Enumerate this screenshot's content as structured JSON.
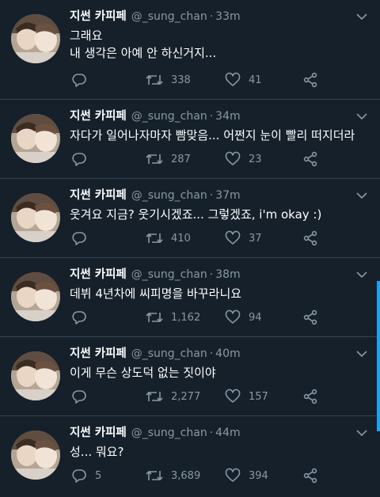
{
  "colors": {
    "background": "#15202b",
    "divider": "#38444d",
    "secondary_text": "#8899a6",
    "scroll_accent": "#1da1f2"
  },
  "tweets": [
    {
      "name": "지썬 카피페",
      "handle": "@_sung_chan",
      "sep": "·",
      "time": "33m",
      "lines": [
        "그래요",
        "내 생각은 아예 안 하신거지..."
      ],
      "replies": "",
      "retweets": "338",
      "likes": "41"
    },
    {
      "name": "지썬 카피페",
      "handle": "@_sung_chan",
      "sep": "·",
      "time": "34m",
      "lines": [
        "자다가 일어나자마자 빰맞음... 어쩐지 눈이 빨리 떠지더라"
      ],
      "replies": "",
      "retweets": "287",
      "likes": "23"
    },
    {
      "name": "지썬 카피페",
      "handle": "@_sung_chan",
      "sep": "·",
      "time": "37m",
      "lines": [
        "웃겨요 지금? 웃기시겠죠... 그렇겠죠, i'm okay :)"
      ],
      "replies": "",
      "retweets": "410",
      "likes": "37"
    },
    {
      "name": "지썬 카피페",
      "handle": "@_sung_chan",
      "sep": "·",
      "time": "38m",
      "lines": [
        "데뷔 4년차에 씨피명을 바꾸라니요"
      ],
      "replies": "",
      "retweets": "1,162",
      "likes": "94"
    },
    {
      "name": "지썬 카피페",
      "handle": "@_sung_chan",
      "sep": "·",
      "time": "40m",
      "lines": [
        "이게 무슨 상도덕 없는 짓이야"
      ],
      "replies": "",
      "retweets": "2,277",
      "likes": "157"
    },
    {
      "name": "지썬 카피페",
      "handle": "@_sung_chan",
      "sep": "·",
      "time": "44m",
      "lines": [
        "성... 뭐요?"
      ],
      "replies": "5",
      "retweets": "3,689",
      "likes": "394"
    }
  ],
  "icons": {
    "reply": "reply-icon",
    "retweet": "retweet-icon",
    "like": "heart-icon",
    "share": "share-icon",
    "menu": "chevron-down-icon",
    "avatar": "avatar"
  }
}
